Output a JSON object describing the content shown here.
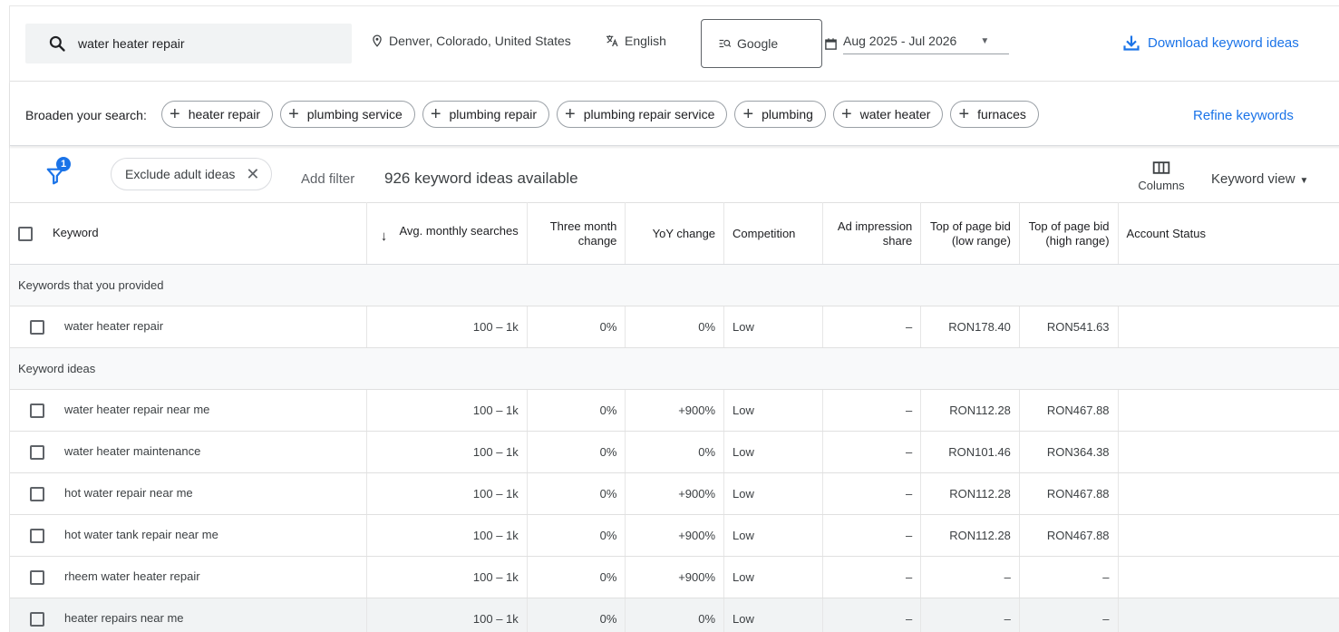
{
  "search": {
    "query": "water heater repair"
  },
  "location": "Denver, Colorado, United States",
  "language": "English",
  "network": "Google",
  "date_range": "Aug 2025 - Jul 2026",
  "download_label": "Download keyword ideas",
  "broaden": {
    "label": "Broaden your search:",
    "chips": [
      "heater repair",
      "plumbing service",
      "plumbing repair",
      "plumbing repair service",
      "plumbing",
      "water heater",
      "furnaces"
    ],
    "refine_label": "Refine keywords"
  },
  "filters": {
    "badge_count": "1",
    "active_filter": "Exclude adult ideas",
    "add_filter": "Add filter",
    "count_text": "926 keyword ideas available",
    "columns_label": "Columns",
    "view_label": "Keyword view"
  },
  "table": {
    "headers": {
      "keyword": "Keyword",
      "avg_searches": "Avg. monthly searches",
      "three_month": "Three month change",
      "yoy": "YoY change",
      "competition": "Competition",
      "ad_share": "Ad impression share",
      "bid_low": "Top of page bid (low range)",
      "bid_high": "Top of page bid (high range)",
      "account_status": "Account Status"
    },
    "provided_group": "Keywords that you provided",
    "provided": [
      {
        "keyword": "water heater repair",
        "avg": "100 – 1k",
        "three": "0%",
        "yoy": "0%",
        "comp": "Low",
        "share": "–",
        "low": "RON178.40",
        "high": "RON541.63"
      }
    ],
    "ideas_group": "Keyword ideas",
    "ideas": [
      {
        "keyword": "water heater repair near me",
        "avg": "100 – 1k",
        "three": "0%",
        "yoy": "+900%",
        "comp": "Low",
        "share": "–",
        "low": "RON112.28",
        "high": "RON467.88"
      },
      {
        "keyword": "water heater maintenance",
        "avg": "100 – 1k",
        "three": "0%",
        "yoy": "0%",
        "comp": "Low",
        "share": "–",
        "low": "RON101.46",
        "high": "RON364.38"
      },
      {
        "keyword": "hot water repair near me",
        "avg": "100 – 1k",
        "three": "0%",
        "yoy": "+900%",
        "comp": "Low",
        "share": "–",
        "low": "RON112.28",
        "high": "RON467.88"
      },
      {
        "keyword": "hot water tank repair near me",
        "avg": "100 – 1k",
        "three": "0%",
        "yoy": "+900%",
        "comp": "Low",
        "share": "–",
        "low": "RON112.28",
        "high": "RON467.88"
      },
      {
        "keyword": "rheem water heater repair",
        "avg": "100 – 1k",
        "three": "0%",
        "yoy": "+900%",
        "comp": "Low",
        "share": "–",
        "low": "–",
        "high": "–"
      },
      {
        "keyword": "heater repairs near me",
        "avg": "100 – 1k",
        "three": "0%",
        "yoy": "0%",
        "comp": "Low",
        "share": "–",
        "low": "–",
        "high": "–"
      }
    ]
  }
}
